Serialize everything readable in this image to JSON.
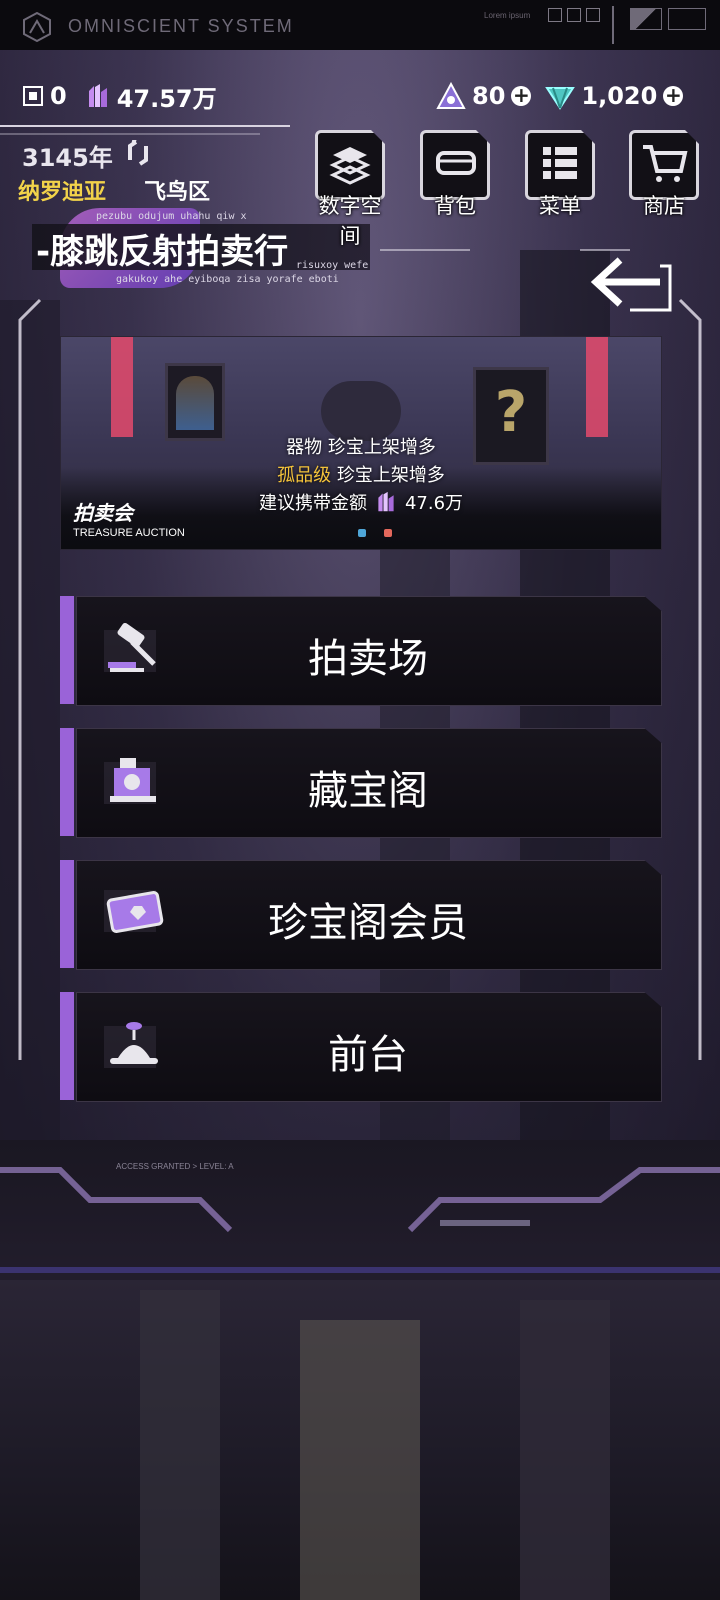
{
  "topbar": {
    "system_title": "OMNISCIENT SYSTEM",
    "lorem": "Lorem ipsum"
  },
  "resources": {
    "left1": "0",
    "left2": "47.57万",
    "energy": "80",
    "gems": "1,020"
  },
  "location": {
    "year": "3145年",
    "region": "纳罗迪亚",
    "district": "飞鸟区",
    "venue": "-膝跳反射拍卖行",
    "tiny_text_1": "pezubu odujum uhahu qiw x",
    "tiny_text_2": "risuxoy wefe",
    "tiny_text_3": "gakukoy ahe eyiboqa zisa yorafe eboti"
  },
  "nav": [
    {
      "label": "数字空间",
      "icon": "digital-space-icon"
    },
    {
      "label": "背包",
      "icon": "backpack-icon"
    },
    {
      "label": "菜单",
      "icon": "menu-list-icon"
    },
    {
      "label": "商店",
      "icon": "shop-cart-icon"
    }
  ],
  "banner": {
    "line1": "器物 珍宝上架增多",
    "line2_highlight": "孤品级",
    "line2_rest": " 珍宝上架增多",
    "line3_prefix": "建议携带金额",
    "line3_amount": "47.6万",
    "title": "拍卖会",
    "subtitle": "TREASURE AUCTION"
  },
  "menu": [
    {
      "label": "拍卖场",
      "icon": "gavel-icon"
    },
    {
      "label": "藏宝阁",
      "icon": "treasure-vault-icon"
    },
    {
      "label": "珍宝阁会员",
      "icon": "member-card-icon"
    },
    {
      "label": "前台",
      "icon": "reception-icon"
    }
  ],
  "footer": {
    "access_text": "ACCESS GRANTED > LEVEL: A"
  },
  "colors": {
    "accent_purple": "#9a63d8",
    "gold": "#f2d34a",
    "highlight_orange": "#f3c23a"
  }
}
